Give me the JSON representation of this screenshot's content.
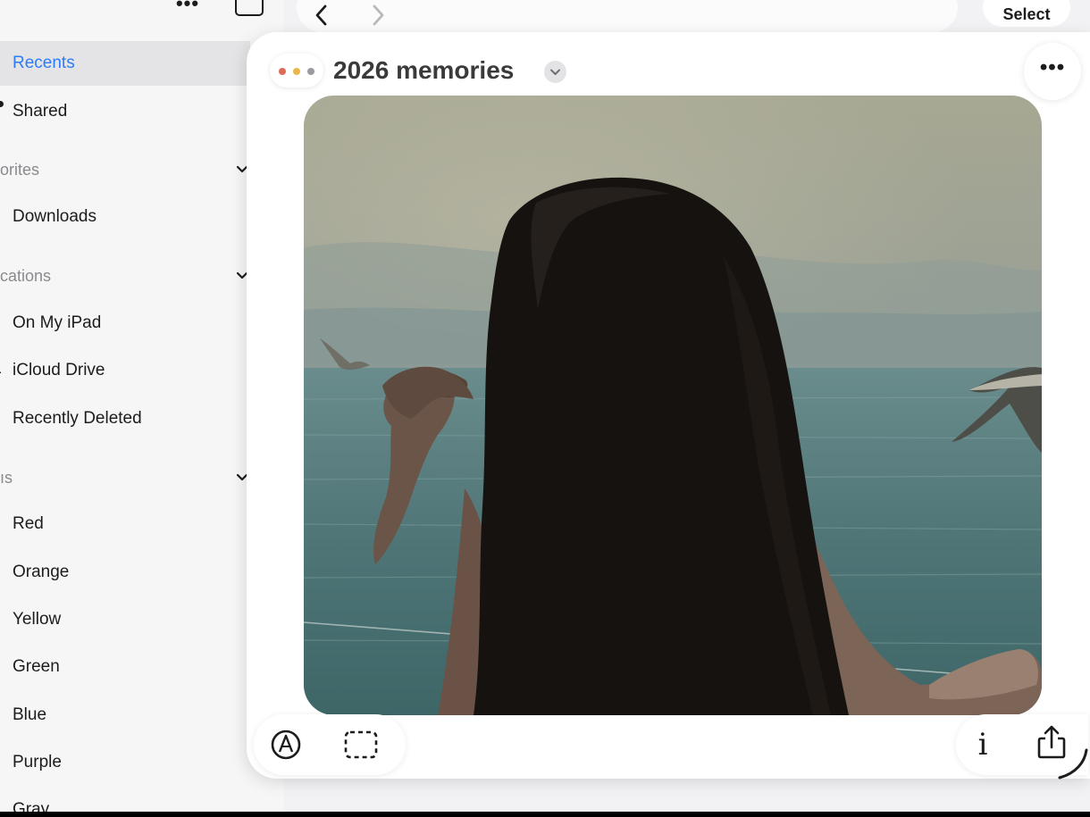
{
  "sidebar": {
    "items": {
      "recents": "Recents",
      "shared": "Shared",
      "downloads": "Downloads",
      "on_my_ipad": "On My iPad",
      "icloud_drive": "iCloud Drive",
      "recently_deleted": "Recently Deleted"
    },
    "sections": {
      "favorites": "orites",
      "locations": "cations",
      "tags": "ıs"
    },
    "tags": [
      "Red",
      "Orange",
      "Yellow",
      "Green",
      "Blue",
      "Purple",
      "Gray"
    ]
  },
  "header": {
    "select_label": "Select"
  },
  "document": {
    "title": "2026 memories"
  },
  "icons": {
    "more": "•••",
    "chevron_down": "⌄",
    "info": "i"
  },
  "colors": {
    "accent": "#2d7cf6",
    "window_dot_red": "#e06a5a",
    "window_dot_yellow": "#e8b84a",
    "window_dot_gray": "#9a9aa0"
  }
}
